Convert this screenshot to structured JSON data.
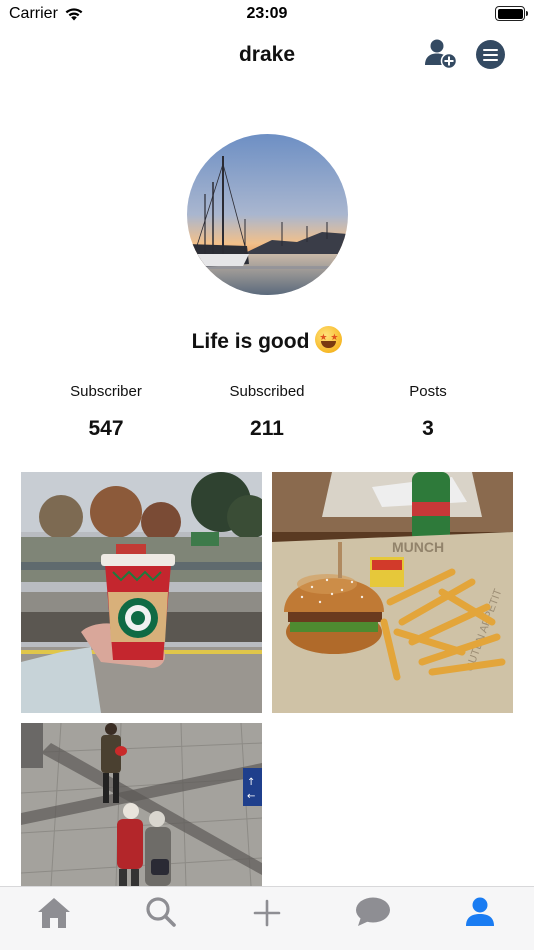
{
  "status_bar": {
    "carrier": "Carrier",
    "time": "23:09"
  },
  "nav": {
    "title": "drake",
    "add_user_icon": "person-add-icon",
    "menu_icon": "hamburger-menu-icon"
  },
  "profile": {
    "bio_text": "Life is good",
    "bio_emoji": "star-struck-emoji"
  },
  "stats": [
    {
      "label": "Subscriber",
      "value": "547"
    },
    {
      "label": "Subscribed",
      "value": "211"
    },
    {
      "label": "Posts",
      "value": "3"
    }
  ],
  "posts": [
    {
      "subject": "starbucks-cup-photo"
    },
    {
      "subject": "burger-and-fries-photo"
    },
    {
      "subject": "station-people-photo"
    }
  ],
  "tab_bar": {
    "tabs": [
      "home-icon",
      "search-icon",
      "add-icon",
      "chat-icon",
      "profile-icon"
    ],
    "active_tab": "profile-icon",
    "active_color": "#1a7cf2",
    "inactive_color": "#8e8e93"
  }
}
